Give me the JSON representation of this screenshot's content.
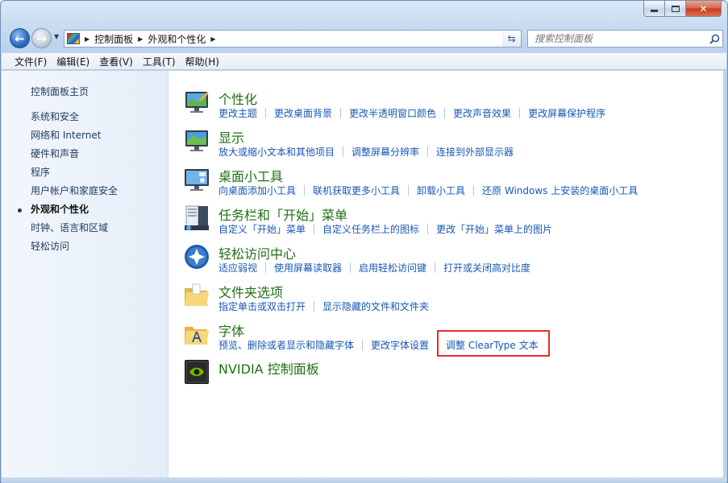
{
  "nav": {
    "breadcrumb": [
      "控制面板",
      "外观和个性化"
    ],
    "search_placeholder": "搜索控制面板"
  },
  "menu": [
    "文件(F)",
    "编辑(E)",
    "查看(V)",
    "工具(T)",
    "帮助(H)"
  ],
  "sidebar": {
    "home": "控制面板主页",
    "items": [
      {
        "label": "系统和安全"
      },
      {
        "label": "网络和 Internet"
      },
      {
        "label": "硬件和声音"
      },
      {
        "label": "程序"
      },
      {
        "label": "用户帐户和家庭安全"
      },
      {
        "label": "外观和个性化",
        "active": true
      },
      {
        "label": "时钟、语言和区域"
      },
      {
        "label": "轻松访问"
      }
    ]
  },
  "categories": [
    {
      "title": "个性化",
      "icon": "personalization-icon",
      "links": [
        "更改主题",
        "更改桌面背景",
        "更改半透明窗口颜色",
        "更改声音效果",
        "更改屏幕保护程序"
      ]
    },
    {
      "title": "显示",
      "icon": "display-icon",
      "links": [
        "放大或缩小文本和其他项目",
        "调整屏幕分辨率",
        "连接到外部显示器"
      ]
    },
    {
      "title": "桌面小工具",
      "icon": "gadgets-icon",
      "links": [
        "向桌面添加小工具",
        "联机获取更多小工具",
        "卸载小工具",
        "还原 Windows 上安装的桌面小工具"
      ]
    },
    {
      "title": "任务栏和「开始」菜单",
      "icon": "taskbar-icon",
      "links": [
        "自定义「开始」菜单",
        "自定义任务栏上的图标",
        "更改「开始」菜单上的图片"
      ]
    },
    {
      "title": "轻松访问中心",
      "icon": "ease-of-access-icon",
      "links": [
        "适应弱视",
        "使用屏幕读取器",
        "启用轻松访问键",
        "打开或关闭高对比度"
      ]
    },
    {
      "title": "文件夹选项",
      "icon": "folder-icon",
      "links": [
        "指定单击或双击打开",
        "显示隐藏的文件和文件夹"
      ]
    },
    {
      "title": "字体",
      "icon": "fonts-icon",
      "links": [
        "预览、删除或者显示和隐藏字体",
        "更改字体设置",
        "调整 ClearType 文本"
      ]
    },
    {
      "title": "NVIDIA 控制面板",
      "icon": "nvidia-icon",
      "links": []
    }
  ],
  "colors": {
    "title_green": "#1f6e16",
    "link_blue": "#1757b4",
    "highlight_red": "#e0302a"
  }
}
